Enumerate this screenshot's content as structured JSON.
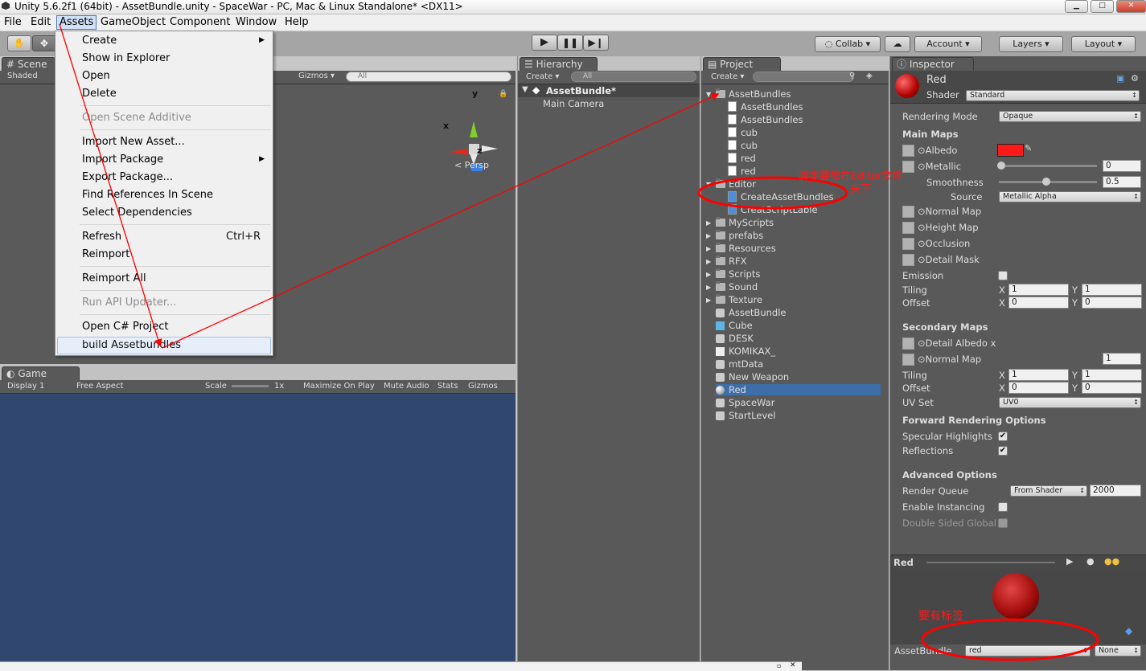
{
  "window": {
    "title": "Unity 5.6.2f1 (64bit) - AssetBundle.unity - SpaceWar - PC, Mac & Linux Standalone* <DX11>"
  },
  "menubar": [
    "File",
    "Edit",
    "Assets",
    "GameObject",
    "Component",
    "Window",
    "Help"
  ],
  "toolbar": {
    "collab": "Collab",
    "account": "Account",
    "layers": "Layers",
    "layout": "Layout"
  },
  "assets_menu": {
    "create": "Create",
    "show_in_explorer": "Show in Explorer",
    "open": "Open",
    "delete": "Delete",
    "open_scene_additive": "Open Scene Additive",
    "import_new_asset": "Import New Asset...",
    "import_package": "Import Package",
    "export_package": "Export Package...",
    "find_references": "Find References In Scene",
    "select_dependencies": "Select Dependencies",
    "refresh": "Refresh",
    "refresh_shortcut": "Ctrl+R",
    "reimport": "Reimport",
    "reimport_all": "Reimport All",
    "run_api_updater": "Run API Updater...",
    "open_csharp": "Open C# Project",
    "build_assetbundles": "build Assetbundles"
  },
  "scene": {
    "tab": "Scene",
    "shaded": "Shaded",
    "gizmos": "Gizmos",
    "search": "All",
    "persp": "Persp",
    "axis_x": "x",
    "axis_y": "y",
    "axis_z": "z"
  },
  "game": {
    "tab": "Game",
    "display": "Display 1",
    "aspect": "Free Aspect",
    "scale": "Scale",
    "scale_value": "1x",
    "maximize": "Maximize On Play",
    "mute": "Mute Audio",
    "stats": "Stats",
    "gizmos": "Gizmos"
  },
  "hierarchy": {
    "tab": "Hierarchy",
    "create": "Create",
    "search": "All",
    "scene": "AssetBundle*",
    "items": [
      "Main Camera"
    ]
  },
  "project": {
    "tab": "Project",
    "create": "Create",
    "assetbundles_folder": "AssetBundles",
    "assetbundles_children": [
      "AssetBundles",
      "AssetBundles",
      "cub",
      "cub",
      "red",
      "red"
    ],
    "editor_folder": "Editor",
    "editor_children": [
      "CreateAssetBundles",
      "CreatScriptLable"
    ],
    "folders": [
      "MyScripts",
      "prefabs",
      "Resources",
      "RFX",
      "Scripts",
      "Sound",
      "Texture"
    ],
    "files": [
      "AssetBundle",
      "Cube",
      "DESK",
      "KOMIKAX_",
      "mtData",
      "New Weapon",
      "Red",
      "SpaceWar",
      "StartLevel"
    ]
  },
  "inspector": {
    "tab": "Inspector",
    "name": "Red",
    "shader_label": "Shader",
    "shader": "Standard",
    "rendering_mode_label": "Rendering Mode",
    "rendering_mode": "Opaque",
    "main_maps": "Main Maps",
    "albedo": "Albedo",
    "metallic": "Metallic",
    "metallic_value": "0",
    "smoothness": "Smoothness",
    "smoothness_value": "0.5",
    "source": "Source",
    "source_value": "Metallic Alpha",
    "normal_map": "Normal Map",
    "height_map": "Height Map",
    "occlusion": "Occlusion",
    "detail_mask": "Detail Mask",
    "emission": "Emission",
    "tiling": "Tiling",
    "offset": "Offset",
    "x": "X",
    "y": "Y",
    "tiling_x": "1",
    "tiling_y": "1",
    "offset_x": "0",
    "offset_y": "0",
    "secondary_maps": "Secondary Maps",
    "detail_albedo": "Detail Albedo x",
    "normal_map2": "Normal Map",
    "normal_map2_value": "1",
    "tiling2_x": "1",
    "tiling2_y": "1",
    "offset2_x": "0",
    "offset2_y": "0",
    "uv_set": "UV Set",
    "uv_set_value": "UV0",
    "forward_options": "Forward Rendering Options",
    "specular": "Specular Highlights",
    "reflections": "Reflections",
    "advanced": "Advanced Options",
    "render_queue": "Render Queue",
    "render_queue_mode": "From Shader",
    "render_queue_value": "2000",
    "enable_instancing": "Enable Instancing",
    "double_sided": "Double Sided Global",
    "preview_name": "Red",
    "assetbundle_label": "AssetBundle",
    "assetbundle_value": "red",
    "assetbundle_variant": "None",
    "albedo_color": "#ff1a1a"
  },
  "annotations": {
    "editor_note_1": "脚本要放在Editor文件",
    "editor_note_2": "夹下",
    "label_note": "要有标签",
    "color": "#ff0000"
  }
}
